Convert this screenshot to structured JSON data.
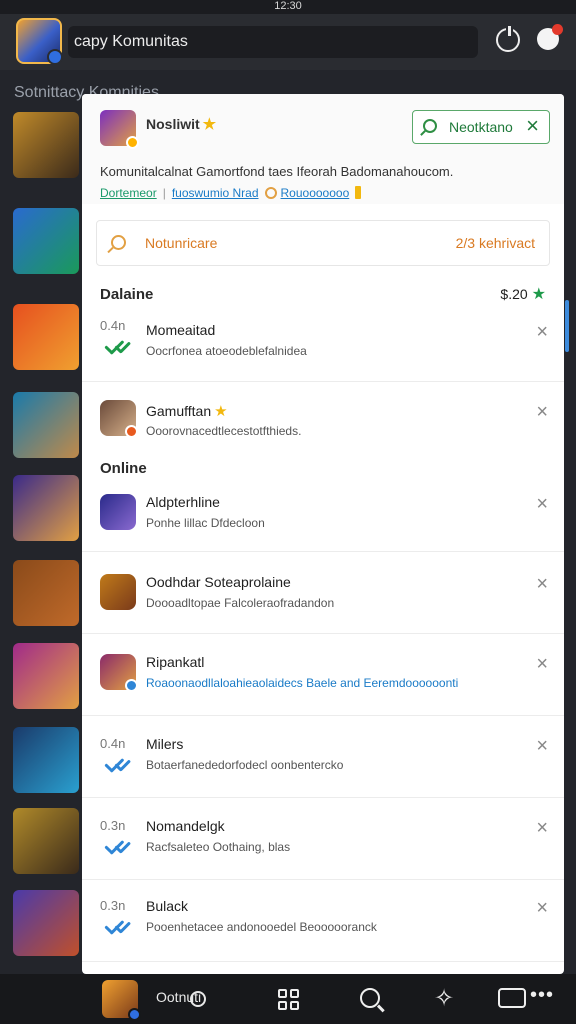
{
  "status_bar": {
    "clock": "12:30"
  },
  "header": {
    "title": "capy Komunitas"
  },
  "background": {
    "heading": "Sotnittacy Komnities"
  },
  "panel": {
    "profile_name": "Nosliwit",
    "action_button": "Neotktano",
    "description": "Komunitalcalnat Gamortfond taes Ifeorah Badomanahoucom.",
    "links": [
      "Dortemeor",
      "fuoswumio Nrad",
      "Rouooooooo"
    ],
    "search": {
      "placeholder": "Notunricare",
      "meta": "2/3 kehrivact"
    },
    "section_1": {
      "title": "Dalaine",
      "value": "$.20"
    },
    "section_2": {
      "title": "Online"
    },
    "rows": [
      {
        "time": "0.4n",
        "name": "Momeaitad",
        "sub": "Oocrfonea atoeodeblefalnidea"
      },
      {
        "time": "",
        "name": "Gamufftan",
        "sub": "Ooorovnacedtlecestotfthieds."
      },
      {
        "time": "",
        "name": "Aldpterhline",
        "sub": "Ponhe lillac Dfdecloon"
      },
      {
        "time": "",
        "name": "Oodhdar Soteaprolaine",
        "sub": "Doooadltopae Falcoleraofradandon"
      },
      {
        "time": "",
        "name": "Ripankatl",
        "sub": "Roaoonaodllaloahieaolaidecs Baele and Eeremdoooooonti"
      },
      {
        "time": "0.4n",
        "name": "Milers",
        "sub": "Botaerfanededorfodecl oonbentercko"
      },
      {
        "time": "0.3n",
        "name": "Nomandelgk",
        "sub": "Racfsaleteo Oothaing, blas"
      },
      {
        "time": "0.3n",
        "name": "Bulack",
        "sub": "Pooenhetacee andonooedel Beoooooranck"
      }
    ]
  },
  "bottom_nav": {
    "label": "Ootnuti"
  },
  "colors": {
    "accent_orange": "#d97a22",
    "accent_green": "#1e9a4a",
    "accent_blue": "#2f86d6"
  }
}
